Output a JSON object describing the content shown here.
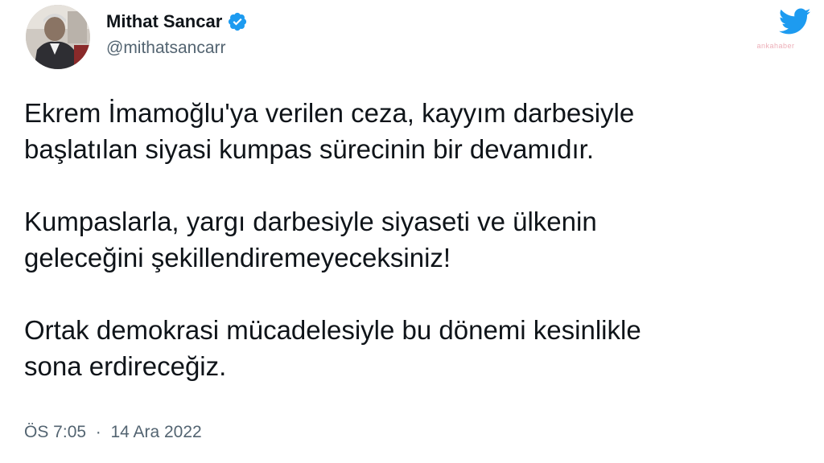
{
  "author": {
    "display_name": "Mithat Sancar",
    "handle": "@mithatsancarr",
    "verified": true,
    "avatar_icon": "profile-photo"
  },
  "tweet": {
    "lines": [
      "Ekrem İmamoğlu'ya verilen ceza, kayyım darbesiyle",
      "başlatılan siyasi kumpas sürecinin bir devamıdır.",
      "Kumpaslarla, yargı darbesiyle siyaseti ve ülkenin",
      "geleceğini şekillendiremeyeceksiniz!",
      "Ortak demokrasi mücadelesiyle bu dönemi kesinlikle",
      "sona erdireceğiz."
    ]
  },
  "meta": {
    "time": "ÖS 7:05",
    "separator": "·",
    "date": "14 Ara 2022"
  },
  "watermark": "ankahaber",
  "colors": {
    "text": "#0f1419",
    "secondary": "#536471",
    "verified_blue": "#1d9bf0",
    "watermark": "#e89aa6"
  },
  "icons": {
    "verified": "verified-badge-icon",
    "brand": "twitter-bird-icon"
  }
}
